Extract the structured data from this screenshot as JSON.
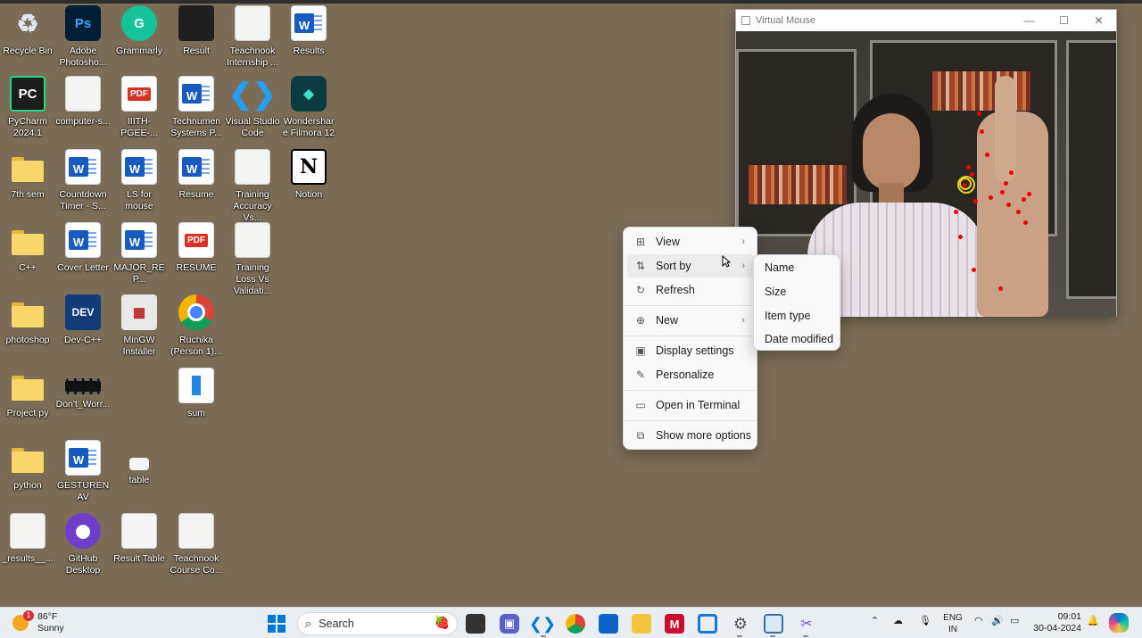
{
  "desktop": {
    "icons": [
      {
        "label": "Recycle Bin",
        "glyph": "♻"
      },
      {
        "label": "Adobe Photosho...",
        "glyph": "Ps"
      },
      {
        "label": "Grammarly",
        "glyph": "G"
      },
      {
        "label": "Result",
        "glyph": ""
      },
      {
        "label": "Teachnook Internship ...",
        "glyph": ""
      },
      {
        "label": "Results",
        "glyph": "W"
      },
      {
        "label": "PyCharm 2024.1",
        "glyph": "PC"
      },
      {
        "label": "computer-s...",
        "glyph": ""
      },
      {
        "label": "IIITH-PGEE-...",
        "glyph": "PDF"
      },
      {
        "label": "Technumen Systems P...",
        "glyph": "W"
      },
      {
        "label": "Visual Studio Code",
        "glyph": "❮❯"
      },
      {
        "label": "Wondershare Filmora 12",
        "glyph": "◆"
      },
      {
        "label": "7th sem",
        "glyph": ""
      },
      {
        "label": "Countdown Timer - S...",
        "glyph": "W"
      },
      {
        "label": "LS for mouse",
        "glyph": "W"
      },
      {
        "label": "Resume",
        "glyph": "W"
      },
      {
        "label": "Training Accuracy Vs...",
        "glyph": ""
      },
      {
        "label": "Notion",
        "glyph": "N"
      },
      {
        "label": "C++",
        "glyph": ""
      },
      {
        "label": "Cover Letter",
        "glyph": "W"
      },
      {
        "label": "MAJOR_REP...",
        "glyph": "W"
      },
      {
        "label": "RESUME",
        "glyph": "PDF"
      },
      {
        "label": "Training Loss Vs Validati...",
        "glyph": ""
      },
      {
        "label": "photoshop",
        "glyph": ""
      },
      {
        "label": "Dev-C++",
        "glyph": "DEV"
      },
      {
        "label": "MinGW Installer",
        "glyph": "▦"
      },
      {
        "label": "Ruchika (Person 1)...",
        "glyph": ""
      },
      {
        "label": "Project py",
        "glyph": ""
      },
      {
        "label": "Don't_Worr...",
        "glyph": ""
      },
      {
        "label": "sum",
        "glyph": ""
      },
      {
        "label": "python",
        "glyph": ""
      },
      {
        "label": "GESTURENAV",
        "glyph": "W"
      },
      {
        "label": "table",
        "glyph": ""
      },
      {
        "label": "_results__...",
        "glyph": ""
      },
      {
        "label": "GitHub Desktop",
        "glyph": "⬤"
      },
      {
        "label": "Result Table",
        "glyph": ""
      },
      {
        "label": "Teachnook Course Co...",
        "glyph": ""
      }
    ]
  },
  "window": {
    "title": "Virtual Mouse",
    "minimize": "—",
    "maximize": "☐",
    "close": "✕"
  },
  "context_menu": {
    "items": [
      {
        "label": "View",
        "icon": "grid-icon",
        "glyph": "⊞"
      },
      {
        "label": "Sort by",
        "icon": "sort-icon",
        "glyph": "⇅"
      },
      {
        "label": "Refresh",
        "icon": "refresh-icon",
        "glyph": "↻"
      },
      {
        "label": "New",
        "icon": "plus-circle-icon",
        "glyph": "⊕"
      },
      {
        "label": "Display settings",
        "icon": "display-icon",
        "glyph": "▣"
      },
      {
        "label": "Personalize",
        "icon": "pen-icon",
        "glyph": "✎"
      },
      {
        "label": "Open in Terminal",
        "icon": "terminal-icon",
        "glyph": "▭"
      },
      {
        "label": "Show more options",
        "icon": "more-options-icon",
        "glyph": "⧉"
      }
    ],
    "chevron": "›"
  },
  "sort_submenu": {
    "items": [
      "Name",
      "Size",
      "Item type",
      "Date modified"
    ]
  },
  "taskbar": {
    "weather_temp": "86°F",
    "weather_desc": "Sunny",
    "weather_badge": "1",
    "search_placeholder": "Search",
    "lang_top": "ENG",
    "lang_bottom": "IN",
    "time": "09:01",
    "date": "30-04-2024"
  }
}
